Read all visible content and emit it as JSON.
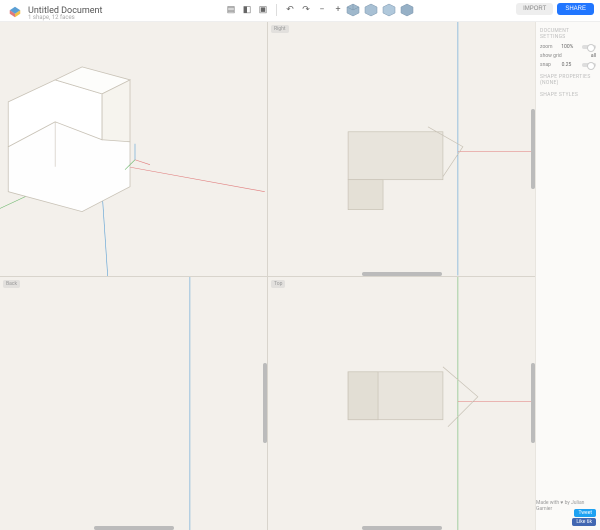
{
  "header": {
    "title": "Untitled Document",
    "subtitle": "1 shape, 12 faces",
    "import_label": "IMPORT",
    "share_label": "SHARE"
  },
  "toolbar": {
    "icons": [
      "file-icon",
      "save-icon",
      "open-icon",
      "undo-icon",
      "redo-icon",
      "plus-icon",
      "minus-icon"
    ],
    "iso_presets": [
      "iso-cube-1",
      "iso-cube-2",
      "iso-cube-3",
      "iso-cube-4"
    ]
  },
  "viewports": {
    "tl": {
      "label": ""
    },
    "tr": {
      "label": "Right"
    },
    "bl": {
      "label": "Back"
    },
    "br": {
      "label": "Top"
    }
  },
  "sidebar": {
    "sections": {
      "doc": {
        "title": "DOCUMENT SETTINGS",
        "rows": [
          {
            "label": "zoom",
            "value": "100%"
          },
          {
            "label": "show grid",
            "value": "all"
          },
          {
            "label": "snap",
            "value": "0.25"
          }
        ]
      },
      "props": {
        "title": "SHAPE PROPERTIES (none)"
      },
      "styles": {
        "title": "SHAPE STYLES"
      }
    }
  },
  "footer": {
    "credit": "Made with ♥ by Julian Garnier",
    "tweet": "Tweet",
    "like": "Like 6k"
  },
  "colors": {
    "accent": "#2176ff",
    "axis_x": "#e07a7a",
    "axis_y": "#6fb86f",
    "axis_z": "#5a9fd4"
  }
}
